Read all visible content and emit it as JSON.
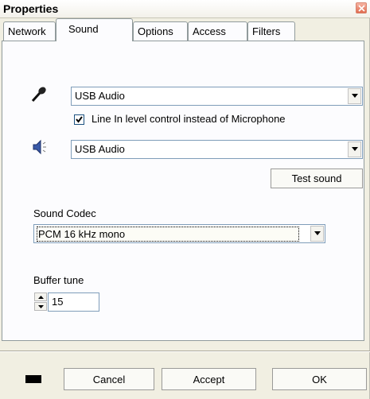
{
  "window": {
    "title": "Properties"
  },
  "tabs": [
    {
      "label": "Network"
    },
    {
      "label": "Sound",
      "active": true
    },
    {
      "label": "Options"
    },
    {
      "label": "Access"
    },
    {
      "label": "Filters"
    }
  ],
  "sound": {
    "mic_device": "USB Audio",
    "line_in_checkbox_label": "Line In level control instead of Microphone",
    "line_in_checked": true,
    "speaker_device": "USB Audio",
    "test_sound_label": "Test sound",
    "codec_label": "Sound Codec",
    "codec_value": "PCM 16 kHz mono",
    "buffer_label": "Buffer tune",
    "buffer_value": "15"
  },
  "footer": {
    "cancel_label": "Cancel",
    "accept_label": "Accept",
    "ok_label": "OK",
    "color_swatch": "#000000"
  },
  "icons": [
    "close-icon",
    "microphone-icon",
    "speaker-icon",
    "dropdown-arrow-icon",
    "spin-up-icon",
    "spin-down-icon",
    "checkmark-icon"
  ]
}
